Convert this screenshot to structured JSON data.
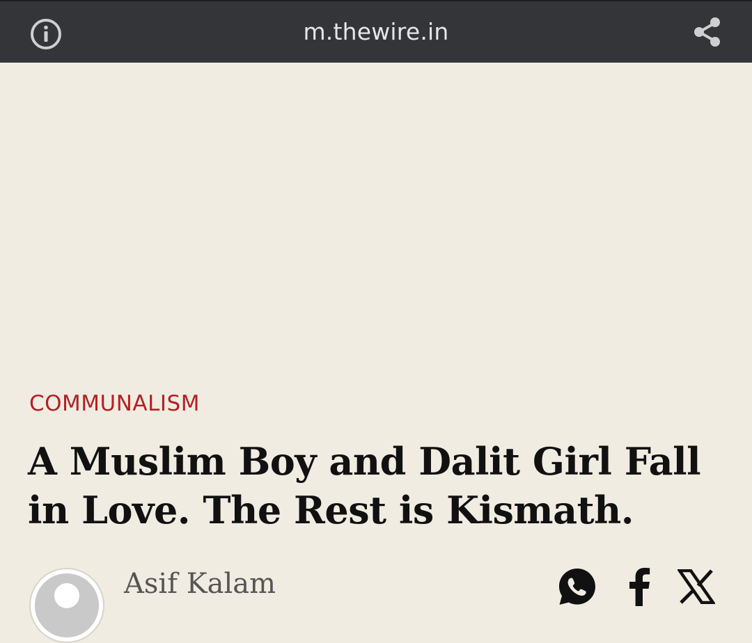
{
  "browser": {
    "url": "m.thewire.in",
    "info_icon": "info-icon",
    "share_icon": "share-icon"
  },
  "article": {
    "category": "COMMUNALISM",
    "headline": "A Muslim Boy and Dalit Girl Fall in Love. The Rest is Kismath.",
    "author": "Asif Kalam"
  },
  "social": [
    "whatsapp-icon",
    "facebook-icon",
    "x-icon"
  ],
  "colors": {
    "topbar": "#333539",
    "page_bg": "#f1ece2",
    "category": "#b51f24",
    "headline": "#111111",
    "author": "#555555"
  }
}
